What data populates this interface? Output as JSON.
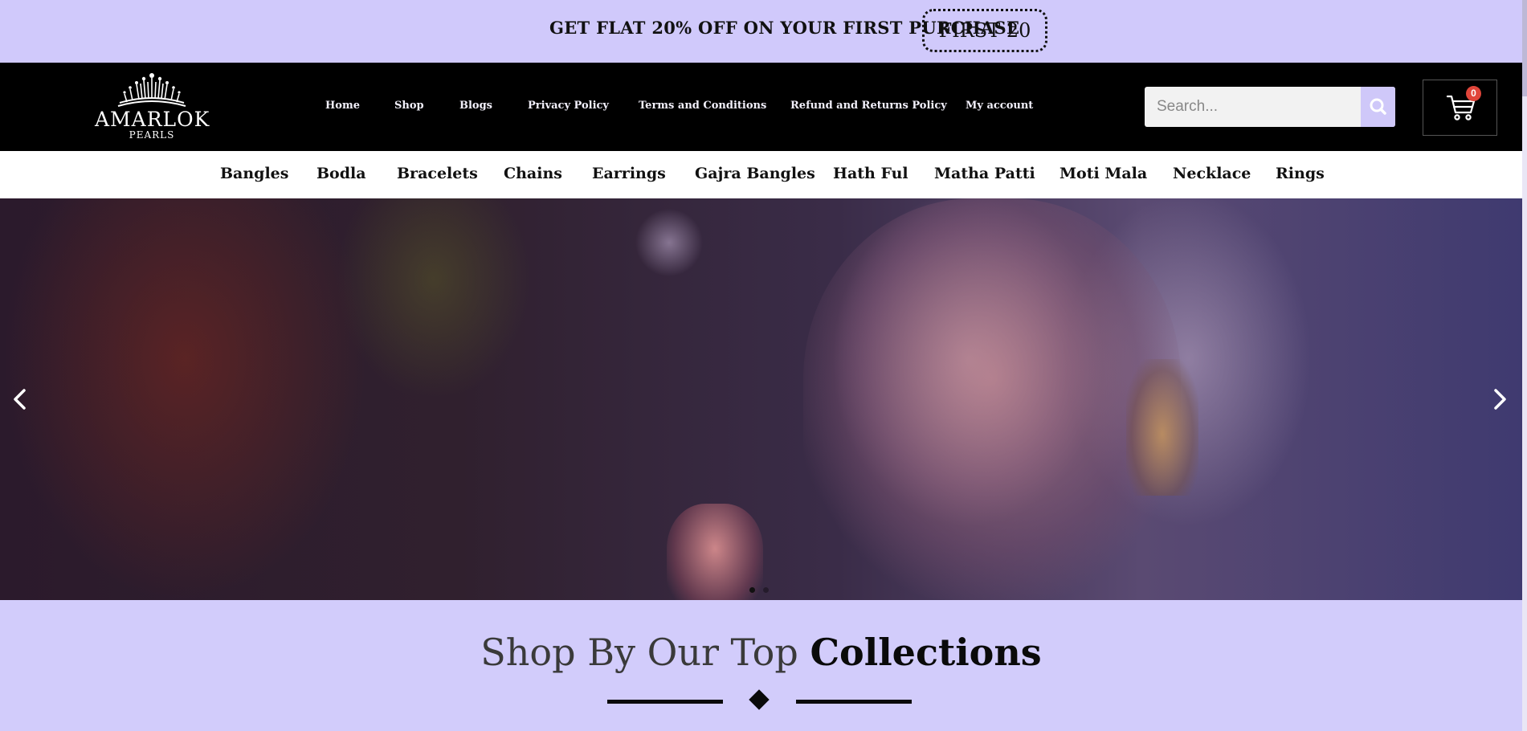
{
  "promo": {
    "text": "GET FLAT 20% OFF ON YOUR FIRST PURCHASE",
    "code": "FIRST 20"
  },
  "brand": {
    "name": "AMARLOK",
    "sub": "PEARLS",
    "logo_icon": "crown-icon"
  },
  "nav": {
    "links": [
      "Home",
      "Shop",
      "Blogs",
      "Privacy Policy",
      "Terms and Conditions",
      "Refund and Returns Policy",
      "My account"
    ]
  },
  "search": {
    "placeholder": "Search...",
    "icon": "search-icon"
  },
  "cart": {
    "count": "0",
    "icon": "cart-icon"
  },
  "categories": [
    "Bangles",
    "Bodla",
    "Bracelets",
    "Chains",
    "Earrings",
    "Gajra Bangles",
    "Hath Ful",
    "Matha Patti",
    "Moti Mala",
    "Necklace",
    "Rings"
  ],
  "hero": {
    "prev_icon": "chevron-left-icon",
    "next_icon": "chevron-right-icon",
    "slides": 2,
    "active_slide": 1
  },
  "section": {
    "title_part1": "Shop By Our Top ",
    "title_part2": "Collections"
  },
  "colors": {
    "accent": "#d0c9fb",
    "badge": "#e0453a",
    "nav_bg": "#000000"
  }
}
